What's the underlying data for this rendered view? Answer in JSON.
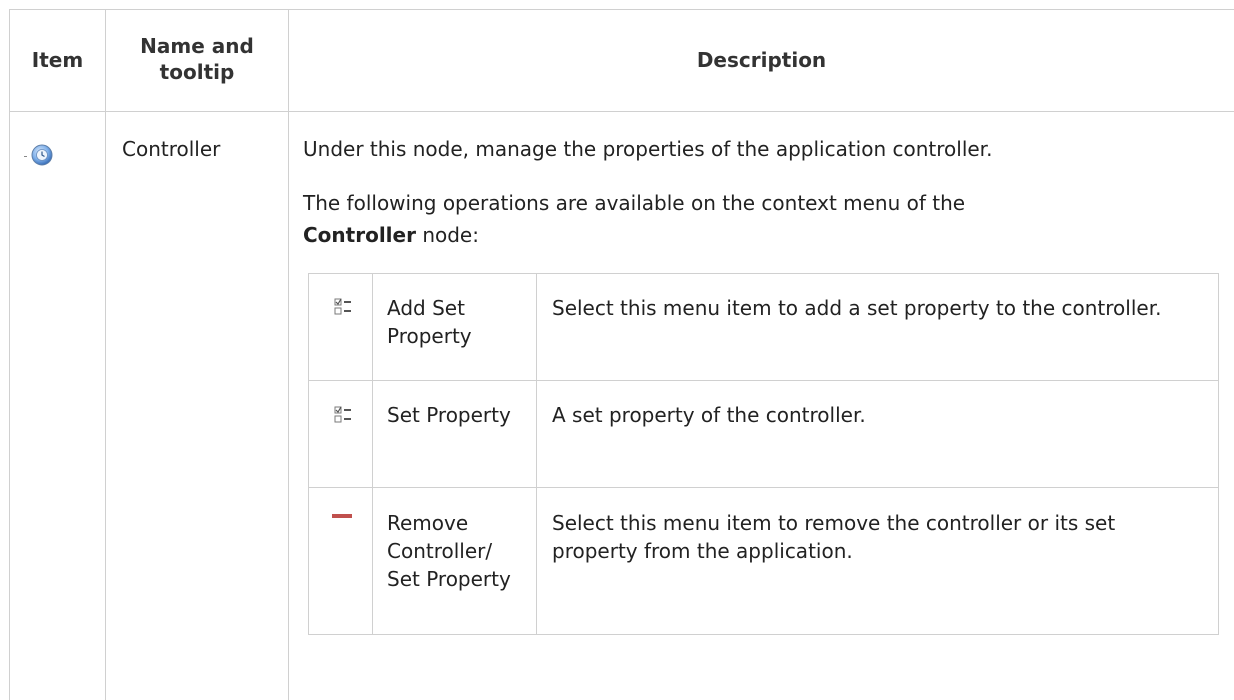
{
  "headers": {
    "item": "Item",
    "name_tooltip": "Name and tooltip",
    "description": "Description"
  },
  "row": {
    "icon": "controller-globe-icon",
    "name": "Controller",
    "desc_line1": "Under this node, manage the properties of the application controller.",
    "desc_line2_prefix": "The following operations are available on the context menu of the",
    "desc_line2_bold": "Controller",
    "desc_line2_suffix": " node:"
  },
  "operations": [
    {
      "icon": "add-set-property-icon",
      "name": "Add Set Property",
      "description": "Select this menu item to add a set property to the controller."
    },
    {
      "icon": "set-property-icon",
      "name": "Set Property",
      "description": "A set property of the controller."
    },
    {
      "icon": "remove-icon",
      "name": "Remove Controller/ Set Property",
      "description": "Select this menu item to remove the controller or its set property from the application."
    }
  ],
  "colors": {
    "grid": "#d0d0d0",
    "remove_icon": "#c0504d",
    "globe": "#3a7bd5"
  }
}
